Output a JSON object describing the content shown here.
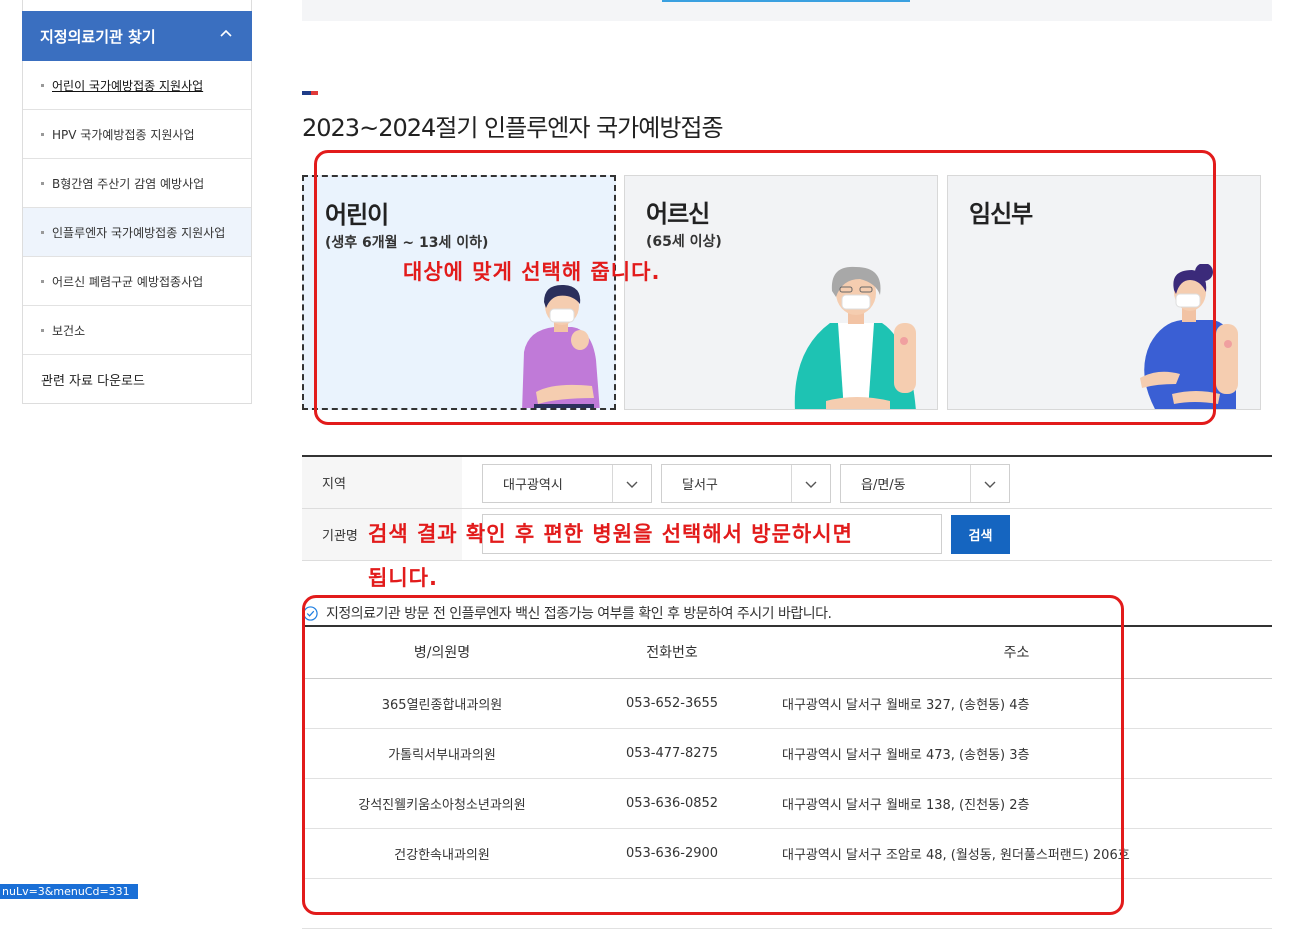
{
  "sidebar": {
    "header": "지정의료기관 찾기",
    "items": [
      {
        "label": "어린이 국가예방접종 지원사업"
      },
      {
        "label": "HPV 국가예방접종 지원사업"
      },
      {
        "label": "B형간염 주산기 감염 예방사업"
      },
      {
        "label": "인플루엔자 국가예방접종 지원사업"
      },
      {
        "label": "어르신 폐렴구균 예방접종사업"
      },
      {
        "label": "보건소"
      }
    ],
    "extra": "관련 자료 다운로드"
  },
  "page_title": "2023~2024절기 인플루엔자 국가예방접종",
  "cards": {
    "child": {
      "title": "어린이",
      "sub": "(생후 6개월 ~ 13세 이하)"
    },
    "senior": {
      "title": "어르신",
      "sub": "(65세 이상)"
    },
    "pregnant": {
      "title": "임신부"
    }
  },
  "annotations": {
    "select_target": "대상에 맞게 선택해 줍니다.",
    "search_result_line1": "검색 결과 확인 후 편한 병원을 선택해서 방문하시면",
    "search_result_line2": "됩니다."
  },
  "form": {
    "region_label": "지역",
    "institution_label": "기관명",
    "city": "대구광역시",
    "district": "달서구",
    "dong": "읍/면/동",
    "search_button": "검색"
  },
  "notice": "지정의료기관 방문 전 인플루엔자 백신 접종가능 여부를 확인 후 방문하여 주시기 바랍니다.",
  "table": {
    "headers": [
      "병/의원명",
      "전화번호",
      "주소"
    ],
    "rows": [
      [
        "365열린종합내과의원",
        "053-652-3655",
        "대구광역시 달서구 월배로 327, (송현동) 4층"
      ],
      [
        "가톨릭서부내과의원",
        "053-477-8275",
        "대구광역시 달서구 월배로 473, (송현동) 3층"
      ],
      [
        "강석진웰키움소아청소년과의원",
        "053-636-0852",
        "대구광역시 달서구 월배로 138, (진천동) 2층"
      ],
      [
        "건강한속내과의원",
        "053-636-2900",
        "대구광역시 달서구 조암로 48, (월성동, 원더풀스퍼랜드) 206호"
      ]
    ]
  },
  "status_url": "nuLv=3&menuCd=331",
  "colors": {
    "accent": "#3a6fc0",
    "button": "#1565c0",
    "annotation": "#e21b1b"
  }
}
